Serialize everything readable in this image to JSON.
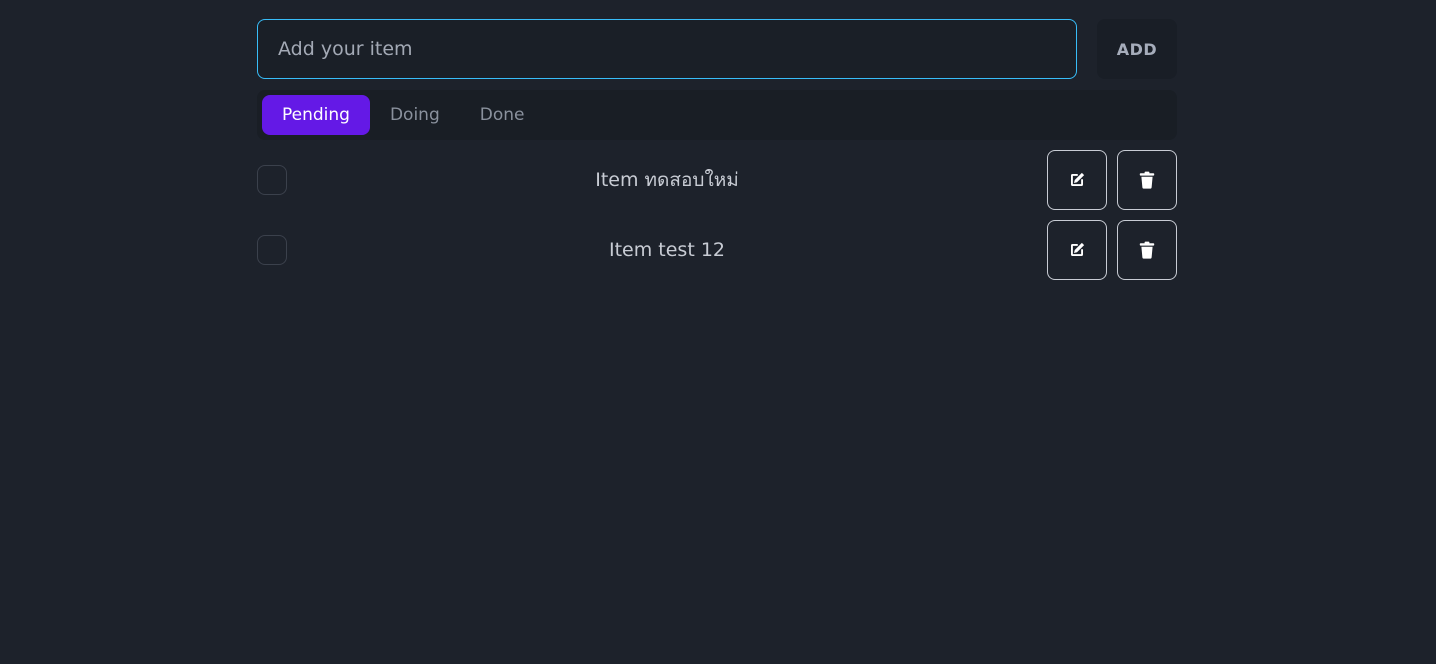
{
  "input": {
    "placeholder": "Add your item",
    "value": ""
  },
  "add_button": {
    "label": "ADD"
  },
  "tabs": [
    {
      "label": "Pending",
      "active": true
    },
    {
      "label": "Doing",
      "active": false
    },
    {
      "label": "Done",
      "active": false
    }
  ],
  "items": [
    {
      "text": "Item ทดสอบใหม่",
      "checked": false
    },
    {
      "text": "Item test 12",
      "checked": false
    }
  ],
  "icons": {
    "edit": "edit-icon",
    "delete": "trash-icon"
  },
  "colors": {
    "background": "#1d222b",
    "accent": "#6419e6",
    "input_border": "#38bdf8"
  }
}
